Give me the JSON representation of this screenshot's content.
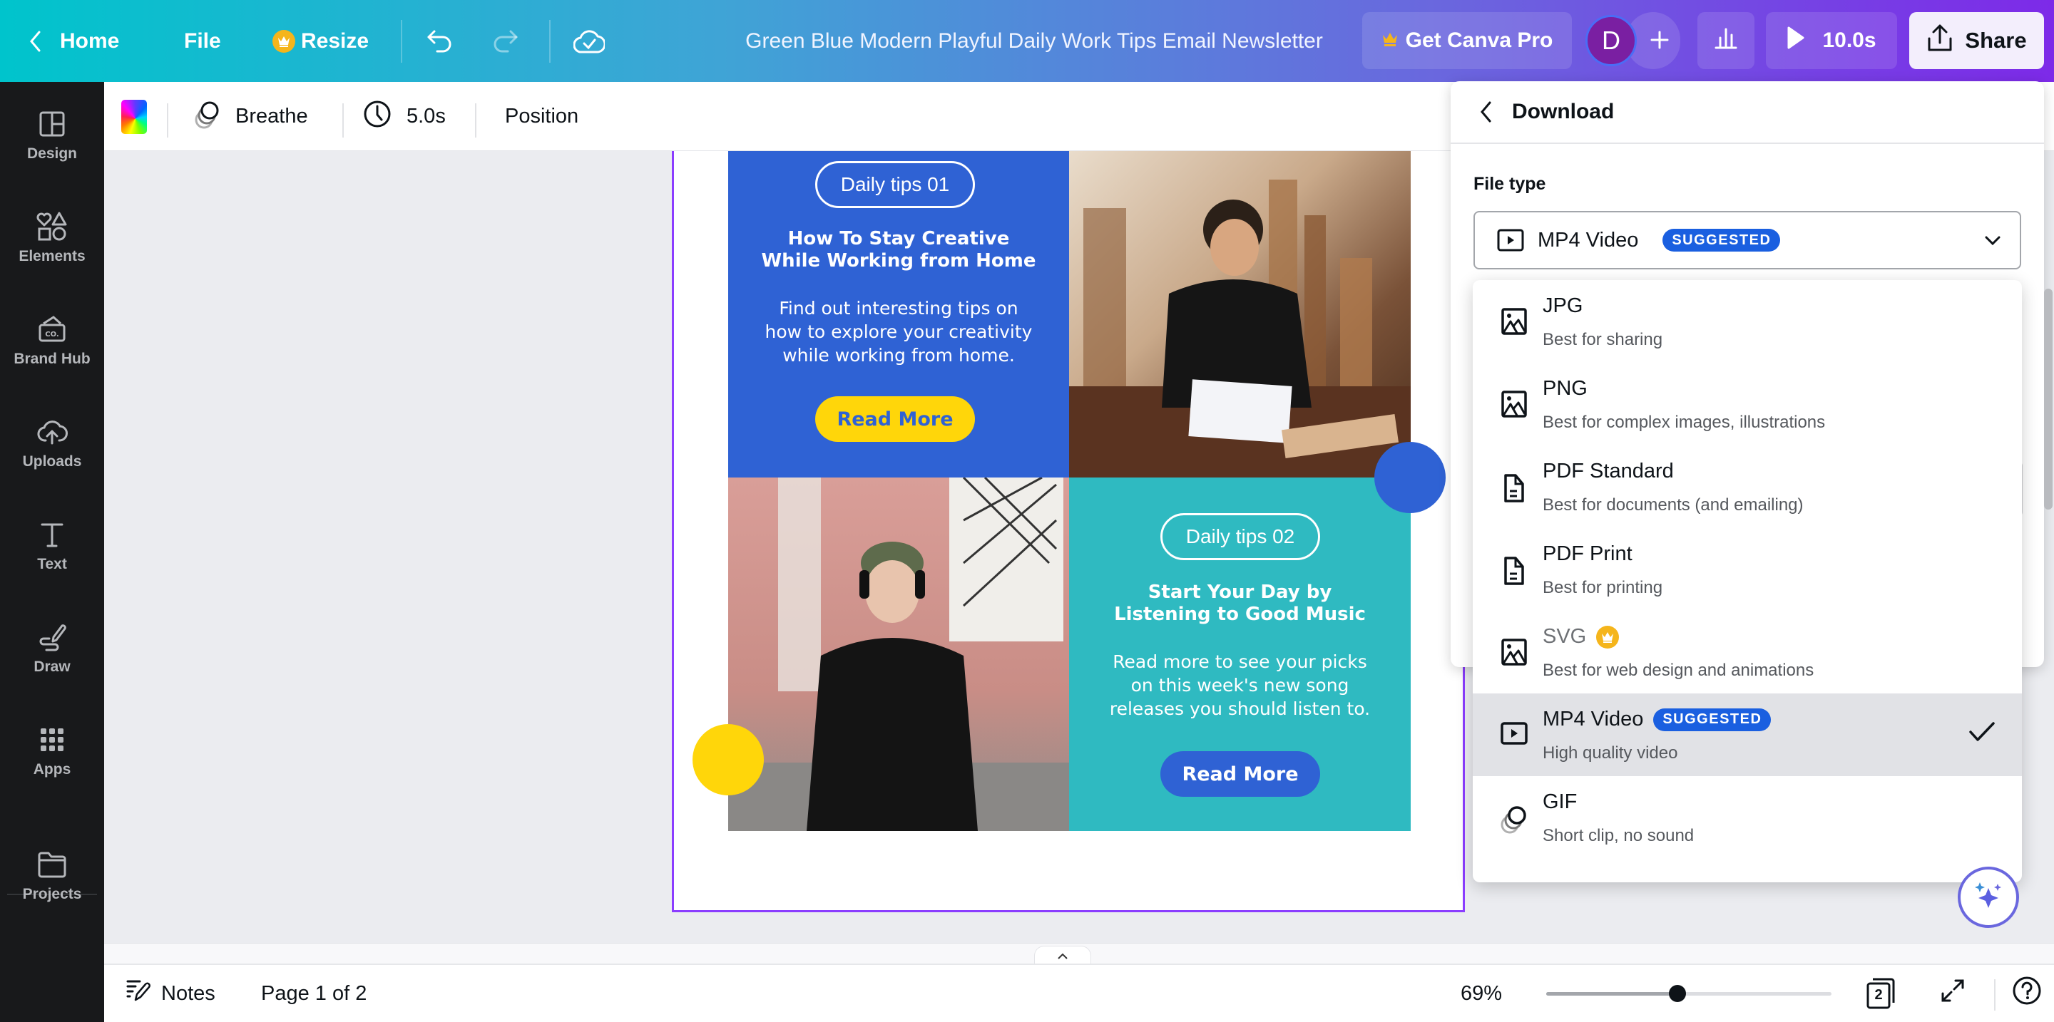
{
  "topbar": {
    "home_label": "Home",
    "file_label": "File",
    "resize_label": "Resize",
    "title": "Green Blue Modern Playful Daily Work Tips Email Newsletter",
    "get_pro_label": "Get Canva Pro",
    "avatar_initial": "D",
    "add_label": "+",
    "play_duration": "10.0s",
    "share_label": "Share",
    "icons": [
      "chevron-left-icon",
      "crown-icon",
      "undo-icon",
      "redo-icon",
      "cloud-saved-icon",
      "crown-icon",
      "plus-icon",
      "analytics-icon",
      "play-icon",
      "share-upload-icon"
    ],
    "colors": {
      "gradient_start": "#00c4cc",
      "gradient_end": "#7d2ae8",
      "crown": "#f5b51b",
      "avatar": "#7a1fa2"
    }
  },
  "sidebar": {
    "items": [
      {
        "label": "Design",
        "icon": "layout-icon"
      },
      {
        "label": "Elements",
        "icon": "shapes-icon"
      },
      {
        "label": "Brand Hub",
        "icon": "brand-hub-icon"
      },
      {
        "label": "Uploads",
        "icon": "cloud-upload-icon"
      },
      {
        "label": "Text",
        "icon": "text-icon"
      },
      {
        "label": "Draw",
        "icon": "draw-icon"
      },
      {
        "label": "Apps",
        "icon": "apps-grid-icon"
      },
      {
        "label": "Projects",
        "icon": "folder-icon"
      }
    ]
  },
  "context_toolbar": {
    "animation_label": "Breathe",
    "duration_label": "5.0s",
    "position_label": "Position"
  },
  "design": {
    "block1": {
      "pill": "Daily tips 01",
      "headline": "How To Stay Creative While Working from Home",
      "body": "Find out interesting tips on how to explore your creativity while working from home.",
      "cta": "Read More"
    },
    "block2": {
      "pill": "Daily tips 02",
      "headline": "Start Your Day by Listening to Good Music",
      "body": "Read more to see your picks on this week's new song releases you should listen to.",
      "cta": "Read More"
    },
    "colors": {
      "blue": "#2f62d4",
      "teal": "#2fbac1",
      "yellow": "#ffd60a",
      "pink": "#f78c9c"
    }
  },
  "download_panel": {
    "title": "Download",
    "file_type_label": "File type",
    "selected_value": "MP4 Video",
    "selected_badge": "SUGGESTED",
    "options": [
      {
        "title": "JPG",
        "subtitle": "Best for sharing",
        "icon": "image-icon"
      },
      {
        "title": "PNG",
        "subtitle": "Best for complex images, illustrations",
        "icon": "image-icon"
      },
      {
        "title": "PDF Standard",
        "subtitle": "Best for documents (and emailing)",
        "icon": "document-icon"
      },
      {
        "title": "PDF Print",
        "subtitle": "Best for printing",
        "icon": "document-icon"
      },
      {
        "title": "SVG",
        "subtitle": "Best for web design and animations",
        "icon": "image-icon",
        "pro": true
      },
      {
        "title": "MP4 Video",
        "subtitle": "High quality video",
        "icon": "video-icon",
        "badge": "SUGGESTED",
        "selected": true
      },
      {
        "title": "GIF",
        "subtitle": "Short clip, no sound",
        "icon": "gif-layers-icon"
      }
    ]
  },
  "bottombar": {
    "notes_label": "Notes",
    "page_indicator": "Page 1 of 2",
    "zoom_level": "69%",
    "zoom_fraction": 0.46,
    "page_count": "2"
  }
}
